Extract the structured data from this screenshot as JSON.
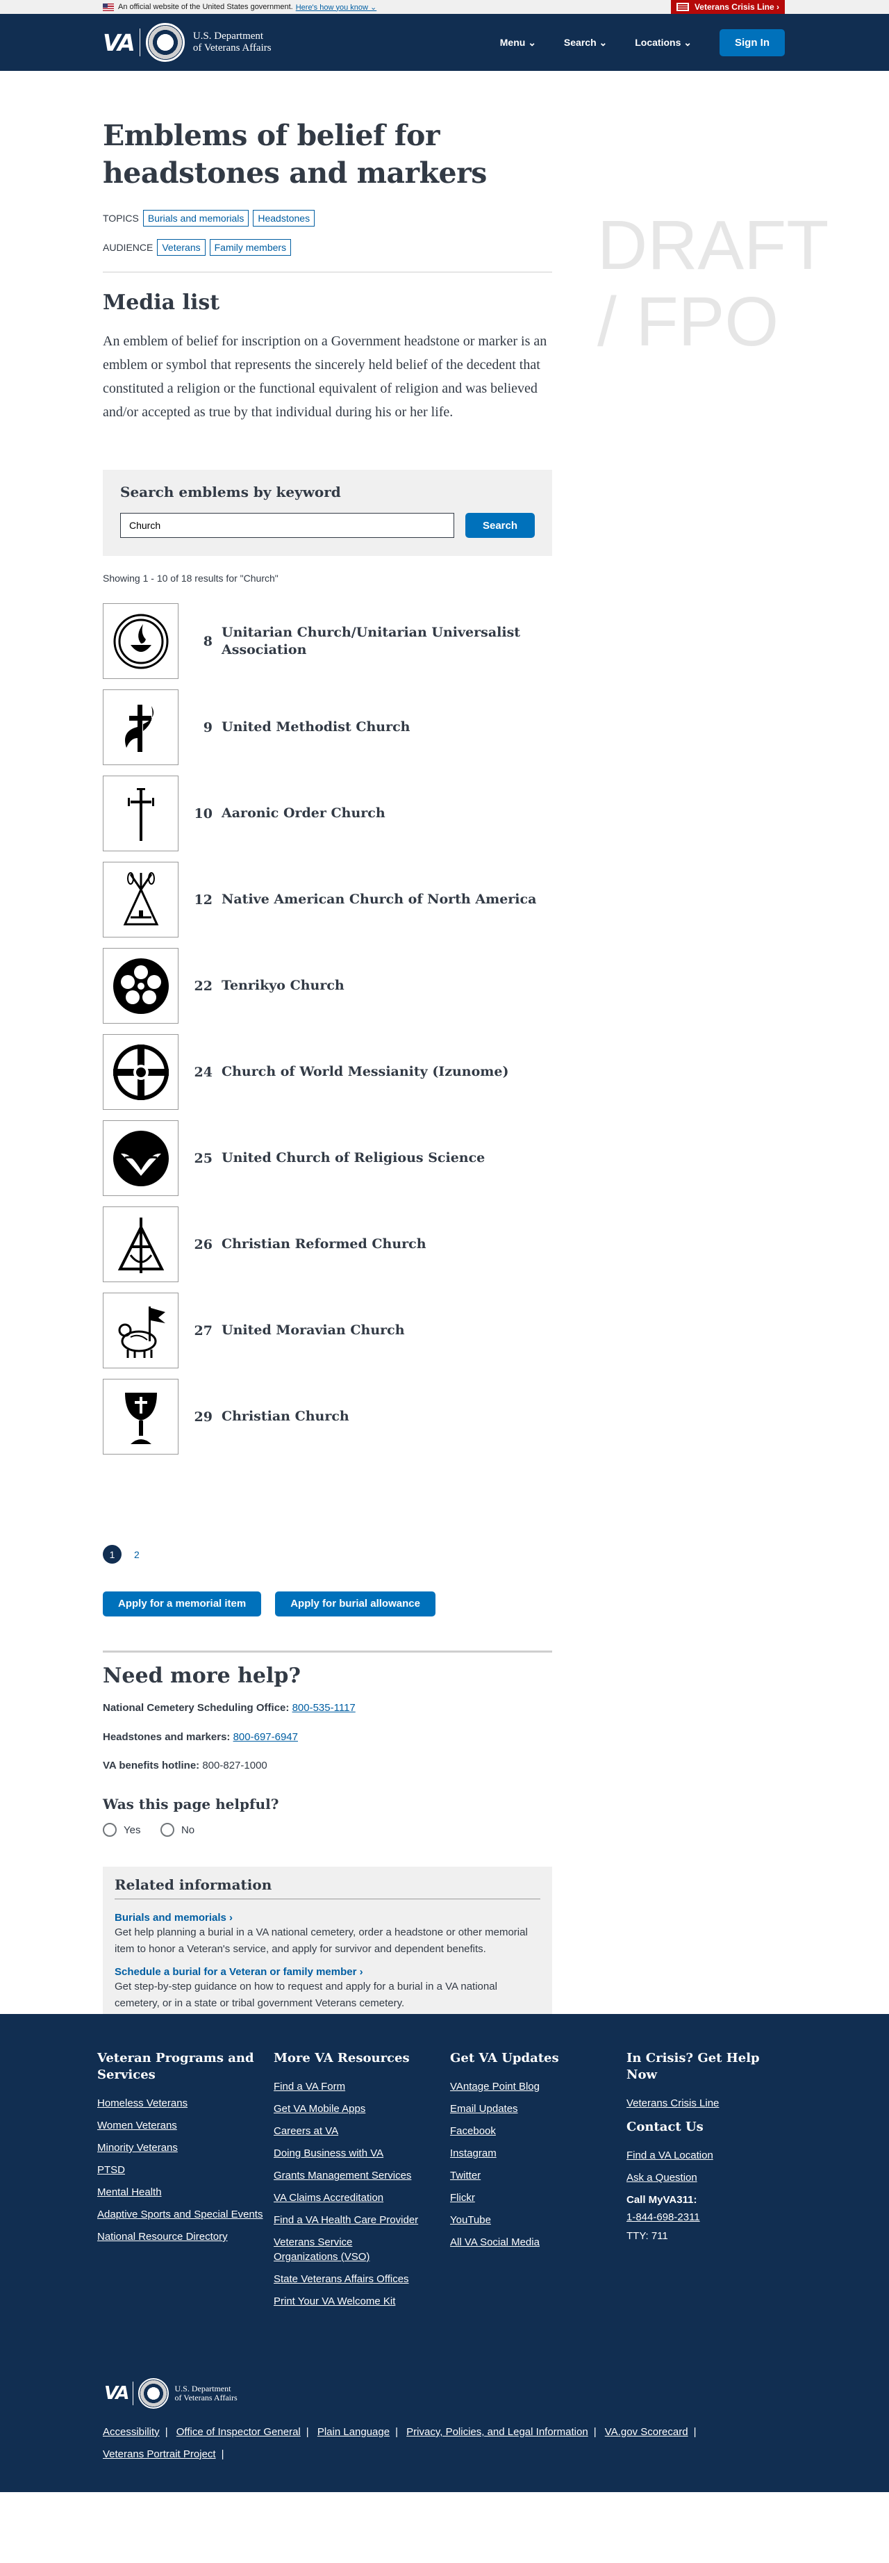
{
  "gov_banner": {
    "text": "An official website of the United States government.",
    "how_link": "Here's how you know ⌄",
    "crisis_line": "Veterans Crisis Line ›"
  },
  "header": {
    "logo": "VA",
    "dept_line1": "U.S. Department",
    "dept_line2": "of Veterans Affairs",
    "nav": {
      "menu": "Menu ⌄",
      "search": "Search ⌄",
      "locations": "Locations ⌄"
    },
    "sign_in": "Sign In"
  },
  "draft_watermark": {
    "line1": "DRAFT",
    "line2": "/ FPO"
  },
  "page": {
    "title_line1": "Emblems of belief for",
    "title_line2": "headstones and markers",
    "topics_label": "TOPICS",
    "topics": [
      "Burials and memorials",
      "Headstones"
    ],
    "audience_label": "AUDIENCE",
    "audience": [
      "Veterans",
      "Family members"
    ]
  },
  "media": {
    "heading": "Media list",
    "intro": "An emblem of belief for inscription on a Government headstone or marker is an emblem or symbol that represents the sincerely held belief of the decedent that constituted a religion or the functional equivalent of religion and was believed and/or accepted as true by that individual during his or her life."
  },
  "search": {
    "heading": "Search emblems by keyword",
    "value": "Church",
    "button": "Search"
  },
  "results": {
    "summary": "Showing 1 - 10 of 18 results for \"Church\"",
    "items": [
      {
        "num": "8",
        "name": "Unitarian Church/Unitarian Universalist Association",
        "icon": "flaming-chalice-icon"
      },
      {
        "num": "9",
        "name": "United Methodist Church",
        "icon": "cross-and-flame-icon"
      },
      {
        "num": "10",
        "name": "Aaronic Order Church",
        "icon": "aaronic-cross-icon"
      },
      {
        "num": "12",
        "name": "Native American Church of North America",
        "icon": "tipi-icon"
      },
      {
        "num": "22",
        "name": "Tenrikyo Church",
        "icon": "tenrikyo-flower-icon"
      },
      {
        "num": "24",
        "name": "Church of World Messianity (Izunome)",
        "icon": "izunome-circle-cross-icon"
      },
      {
        "num": "25",
        "name": "United Church of Religious Science",
        "icon": "religious-science-icon"
      },
      {
        "num": "26",
        "name": "Christian Reformed Church",
        "icon": "christian-reformed-icon"
      },
      {
        "num": "27",
        "name": "United Moravian Church",
        "icon": "moravian-lamb-icon"
      },
      {
        "num": "29",
        "name": "Christian Church",
        "icon": "chalice-icon"
      }
    ]
  },
  "pagination": {
    "current": "1",
    "next": "2"
  },
  "actions": {
    "memorial": "Apply for a memorial item",
    "burial": "Apply for burial allowance"
  },
  "help": {
    "heading": "Need more help?",
    "scheduling_label": "National Cemetery Scheduling Office:",
    "scheduling_phone": "800-535-1117",
    "headstones_label": "Headstones and markers:",
    "headstones_phone": "800-697-6947",
    "benefits_label": "VA benefits hotline:",
    "benefits_phone": "800-827-1000"
  },
  "feedback": {
    "question": "Was this page helpful?",
    "yes": "Yes",
    "no": "No"
  },
  "related": {
    "heading": "Related information",
    "links": [
      {
        "title": "Burials and memorials ›",
        "desc": "Get help planning a burial in a VA national cemetery, order a headstone or other memorial item to honor a Veteran's service, and apply for survivor and dependent benefits."
      },
      {
        "title": "Schedule a burial for a Veteran or family member ›",
        "desc": "Get step-by-step guidance on how to request and apply for a burial in a VA national cemetery, or in a state or tribal government Veterans cemetery."
      }
    ]
  },
  "footer": {
    "col1": {
      "heading": "Veteran Programs and Services",
      "links": [
        "Homeless Veterans",
        "Women Veterans",
        "Minority Veterans",
        "PTSD",
        "Mental Health",
        "Adaptive Sports and Special Events",
        "National Resource Directory"
      ]
    },
    "col2": {
      "heading": "More VA Resources",
      "links": [
        "Find a VA Form",
        "Get VA Mobile Apps",
        "Careers at VA",
        "Doing Business with VA",
        "Grants Management Services",
        "VA Claims Accreditation",
        "Find a VA Health Care Provider",
        "Veterans Service Organizations (VSO)",
        "State Veterans Affairs Offices",
        "Print Your VA Welcome Kit"
      ]
    },
    "col3": {
      "heading": "Get VA Updates",
      "links": [
        "VAntage Point Blog",
        "Email Updates",
        "Facebook",
        "Instagram",
        "Twitter",
        "Flickr",
        "YouTube",
        "All VA Social Media"
      ]
    },
    "col4": {
      "heading": "In Crisis? Get Help Now",
      "crisis_link": "Veterans Crisis Line",
      "contact_heading": "Contact Us",
      "contact_links": [
        "Find a VA Location",
        "Ask a Question"
      ],
      "call_label": "Call MyVA311:",
      "call_phone": "1-844-698-2311",
      "tty": "TTY: 711"
    },
    "bottom_links": [
      "Accessibility",
      "Office of Inspector General",
      "Plain Language",
      "Privacy, Policies, and Legal Information",
      "VA.gov Scorecard",
      "Veterans Portrait Project"
    ]
  }
}
